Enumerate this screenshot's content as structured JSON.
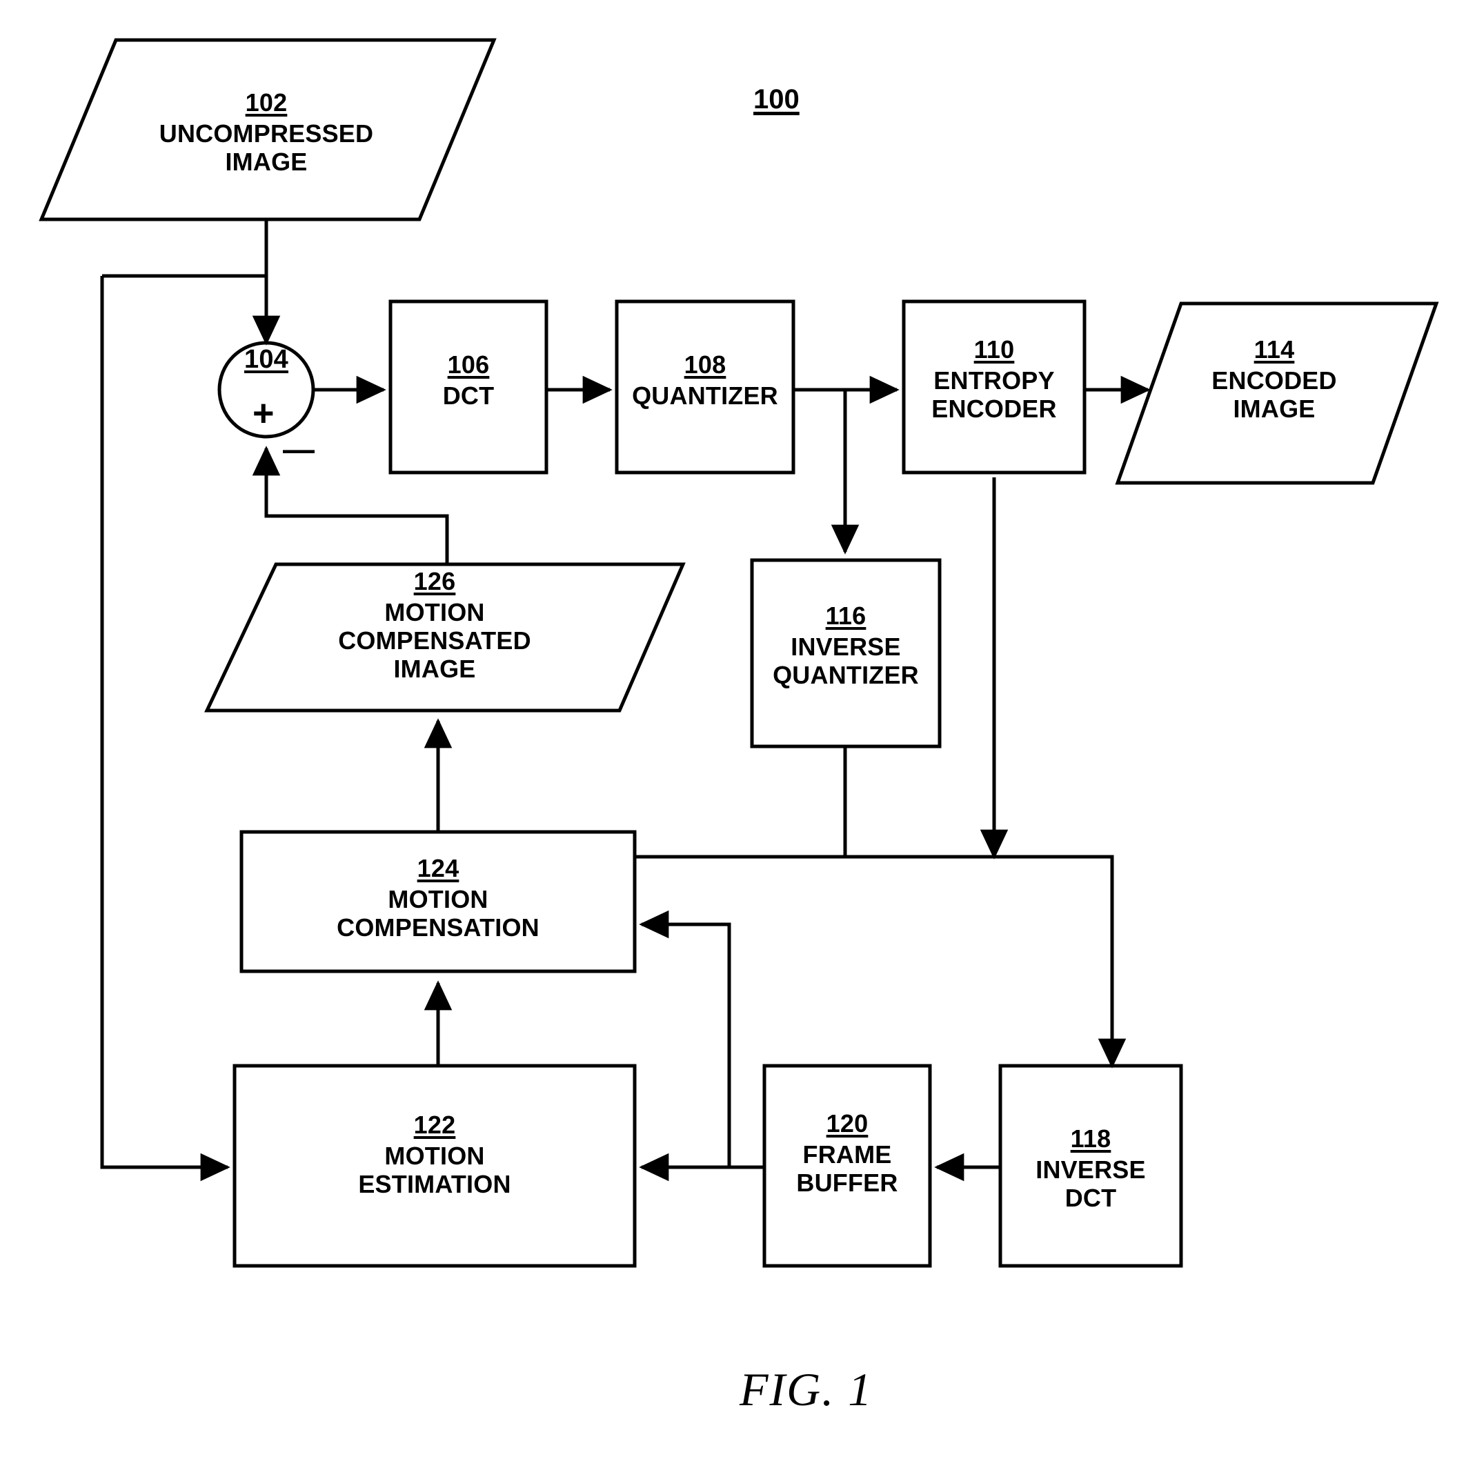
{
  "figure": {
    "system_ref": "100",
    "caption": "FIG. 1",
    "line_color": "#000000",
    "background_color": "#ffffff"
  },
  "nodes": {
    "uncompressed_image": {
      "ref": "102",
      "title": "UNCOMPRESSED\nIMAGE",
      "shape": "parallelogram"
    },
    "summing_junction": {
      "ref": "104",
      "title": "",
      "shape": "circle",
      "plus_sign": "+",
      "minus_sign": "—"
    },
    "dct": {
      "ref": "106",
      "title": "DCT",
      "shape": "rect"
    },
    "quantizer": {
      "ref": "108",
      "title": "QUANTIZER",
      "shape": "rect"
    },
    "entropy_encoder": {
      "ref": "110",
      "title": "ENTROPY\nENCODER",
      "shape": "rect"
    },
    "encoded_image": {
      "ref": "114",
      "title": "ENCODED\nIMAGE",
      "shape": "parallelogram"
    },
    "inverse_quantizer": {
      "ref": "116",
      "title": "INVERSE\nQUANTIZER",
      "shape": "rect"
    },
    "inverse_dct": {
      "ref": "118",
      "title": "INVERSE\nDCT",
      "shape": "rect"
    },
    "frame_buffer": {
      "ref": "120",
      "title": "FRAME\nBUFFER",
      "shape": "rect"
    },
    "motion_estimation": {
      "ref": "122",
      "title": "MOTION\nESTIMATION",
      "shape": "rect"
    },
    "motion_compensation": {
      "ref": "124",
      "title": "MOTION\nCOMPENSATION",
      "shape": "rect"
    },
    "motion_compensated_image": {
      "ref": "126",
      "title": "MOTION\nCOMPENSATED\nIMAGE",
      "shape": "parallelogram"
    }
  }
}
